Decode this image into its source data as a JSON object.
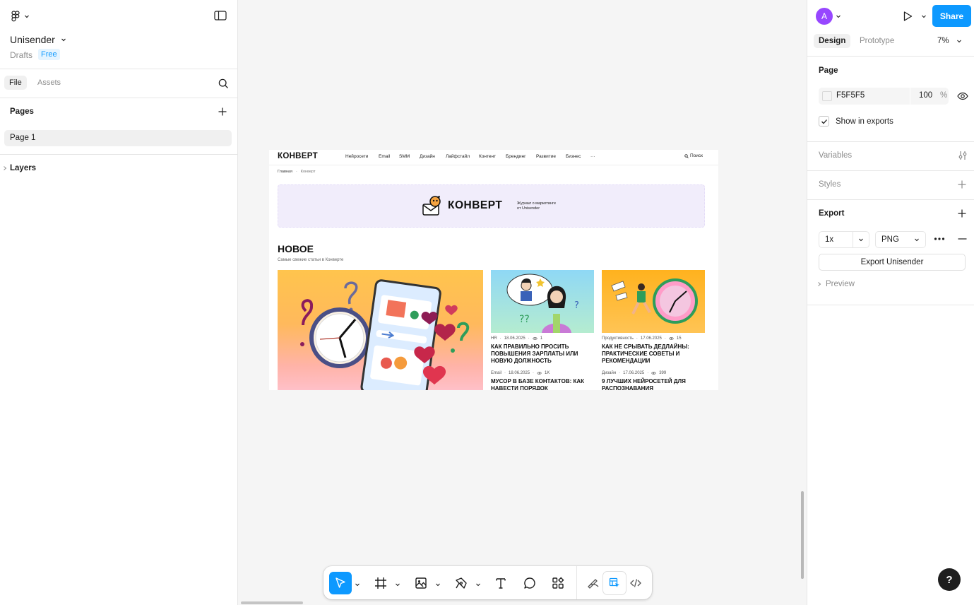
{
  "left_panel": {
    "file_name": "Unisender",
    "location": "Drafts",
    "plan_badge": "Free",
    "tabs": {
      "file": "File",
      "assets": "Assets"
    },
    "pages_heading": "Pages",
    "pages": [
      "Page 1"
    ],
    "layers_heading": "Layers"
  },
  "right_panel": {
    "avatar_letter": "A",
    "share_label": "Share",
    "tabs": {
      "design": "Design",
      "prototype": "Prototype"
    },
    "zoom": "7%",
    "page_heading": "Page",
    "page_color": "F5F5F5",
    "page_opacity": "100",
    "percent_sign": "%",
    "show_in_exports": "Show in exports",
    "variables_heading": "Variables",
    "styles_heading": "Styles",
    "export_heading": "Export",
    "export_scale": "1x",
    "export_format": "PNG",
    "export_button": "Export Unisender",
    "preview_label": "Preview"
  },
  "frame": {
    "logo": "КОНВЕРТ",
    "nav": [
      "Нейросети",
      "Email",
      "SMM",
      "Дизайн",
      "Лайфстайл",
      "Контент",
      "Брендинг",
      "Развитие",
      "Бизнес",
      "···"
    ],
    "search": "Поиск",
    "breadcrumb": [
      "Главная",
      "Конверт"
    ],
    "banner_logo": "КОНВЕРТ",
    "banner_tagline_1": "Журнал о маркетинге",
    "banner_tagline_2": "от Unisender",
    "section_title": "НОВОЕ",
    "section_subtitle": "Самые свежие статьи в Конверте",
    "articles": [
      {
        "category": "HR",
        "date": "18.06.2025",
        "views": "1",
        "title": "КАК ПРАВИЛЬНО ПРОСИТЬ ПОВЫШЕНИЯ ЗАРПЛАТЫ ИЛИ НОВУЮ ДОЛЖНОСТЬ"
      },
      {
        "category": "Продуктивность",
        "date": "17.06.2025",
        "views": "15",
        "title": "КАК НЕ СРЫВАТЬ ДЕДЛАЙНЫ: ПРАКТИЧЕСКИЕ СОВЕТЫ И РЕКОМЕНДАЦИИ"
      },
      {
        "category": "Email",
        "date": "18.06.2025",
        "views": "1K",
        "title": "МУСОР В БАЗЕ КОНТАКТОВ: КАК НАВЕСТИ ПОРЯДОК"
      },
      {
        "category": "Дизайн",
        "date": "17.06.2025",
        "views": "399",
        "title": "9 ЛУЧШИХ НЕЙРОСЕТЕЙ ДЛЯ РАСПОЗНАВАНИЯ"
      }
    ]
  },
  "help_label": "?",
  "colors": {
    "accent": "#0d99ff",
    "avatar": "#9747ff",
    "canvas": "#f5f5f5"
  }
}
